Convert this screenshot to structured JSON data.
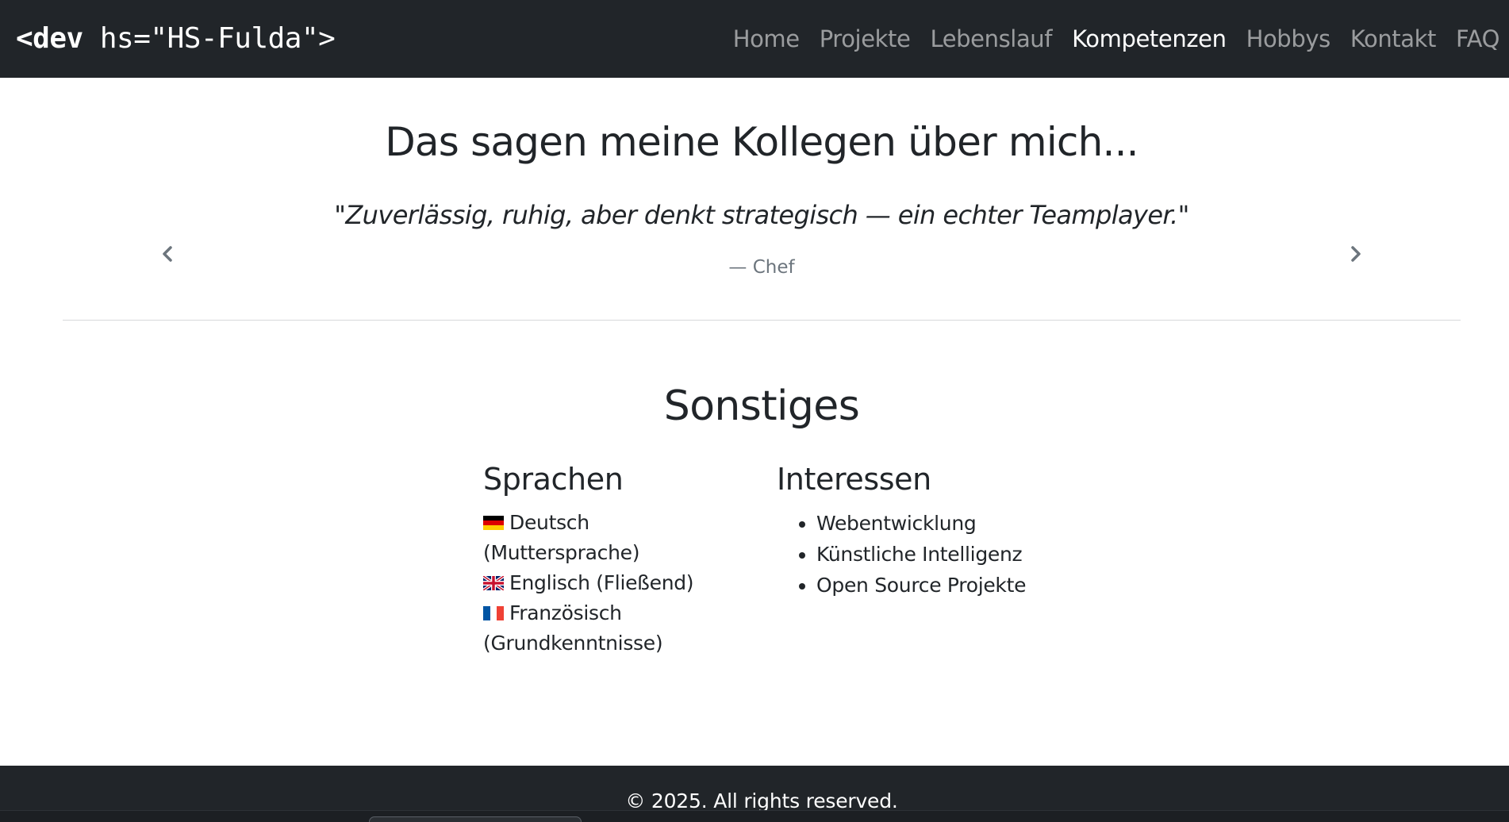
{
  "navbar": {
    "brand_open": "<dev",
    "brand_rest": " hs=\"HS-Fulda\">",
    "links": [
      {
        "label": "Home",
        "active": false
      },
      {
        "label": "Projekte",
        "active": false
      },
      {
        "label": "Lebenslauf",
        "active": false
      },
      {
        "label": "Kompetenzen",
        "active": true
      },
      {
        "label": "Hobbys",
        "active": false
      },
      {
        "label": "Kontakt",
        "active": false
      },
      {
        "label": "FAQ",
        "active": false
      }
    ]
  },
  "testimonials": {
    "heading": "Das sagen meine Kollegen über mich...",
    "quote": "\"Zuverlässig, ruhig, aber denkt strategisch — ein echter Teamplayer.\"",
    "author": "— Chef",
    "prev_icon": "chevron-left-icon",
    "next_icon": "chevron-right-icon"
  },
  "sonstiges": {
    "title": "Sonstiges",
    "languages": {
      "title": "Sprachen",
      "items": [
        {
          "flag": "flag-germany-icon",
          "label": "Deutsch (Muttersprache)"
        },
        {
          "flag": "flag-uk-icon",
          "label": "Englisch (Fließend)"
        },
        {
          "flag": "flag-france-icon",
          "label": "Französisch (Grundkenntnisse)"
        }
      ]
    },
    "interests": {
      "title": "Interessen",
      "items": [
        "Webentwicklung",
        "Künstliche Intelligenz",
        "Open Source Projekte"
      ]
    }
  },
  "footer": {
    "copyright": "© 2025. All rights reserved."
  },
  "colors": {
    "navbar_bg": "#212529",
    "nav_link": "rgba(255,255,255,0.55)",
    "nav_link_active": "#ffffff",
    "muted_text": "#6c757d"
  }
}
